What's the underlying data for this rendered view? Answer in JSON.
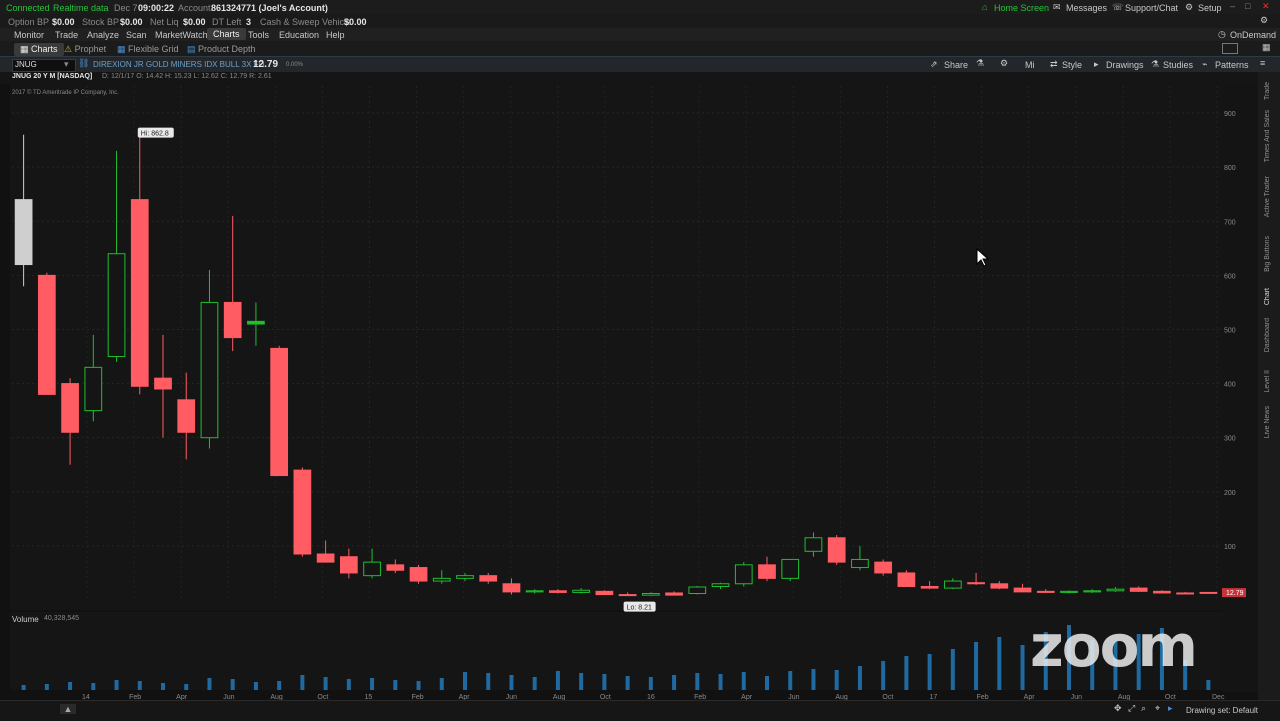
{
  "status": {
    "connected": "Connected",
    "realtime": "Realtime data",
    "date": "Dec 7",
    "time": "09:00:22",
    "account_label": "Account:",
    "account_value": "861324771 (Joel's Account)"
  },
  "balances": [
    {
      "label": "Option BP",
      "value": "$0.00"
    },
    {
      "label": "Stock BP",
      "value": "$0.00"
    },
    {
      "label": "Net Liq",
      "value": "$0.00"
    },
    {
      "label": "DT Left",
      "value": "3"
    },
    {
      "label": "Cash & Sweep Vehicle",
      "value": "$0.00"
    }
  ],
  "top_right": {
    "home": "Home Screen",
    "messages": "Messages",
    "support": "Support/Chat",
    "setup": "Setup",
    "ondemand": "OnDemand"
  },
  "menu": [
    "Monitor",
    "Trade",
    "Analyze",
    "Scan",
    "MarketWatch",
    "Charts",
    "Tools",
    "Education",
    "Help"
  ],
  "subtabs": [
    "Charts",
    "Prophet",
    "Flexible Grid",
    "Product Depth"
  ],
  "chart_header": {
    "symbol": "JNUG",
    "description": "DIREXION JR GOLD MINERS IDX BULL 3X FD",
    "price": "12.79",
    "change": "0.00%",
    "toolbar": [
      "Share",
      "Mi",
      "Style",
      "Drawings",
      "Studies",
      "Patterns"
    ]
  },
  "chart_stats": {
    "title": "JNUG 20 Y M [NASDAQ]",
    "ohlc": "D: 12/1/17   O: 14.42   H: 15.23   L: 12.62   C: 12.79   R: 2.61",
    "copyright": "2017 © TD Ameritrade IP Company, Inc."
  },
  "right_sidebar": [
    "Trade",
    "Times And Sales",
    "Active Trader",
    "Big Buttons",
    "Chart",
    "Dashboard",
    "Level II",
    "Live News"
  ],
  "volume_label": "Volume",
  "volume_value": "40,328,545",
  "drawing_set": "Drawing set: Default",
  "watermark": "zoom",
  "chart_data": {
    "type": "candlestick",
    "title": "JNUG 20 Y M [NASDAQ]",
    "ylim": [
      0,
      950
    ],
    "y_ticks": [
      900,
      800,
      700,
      600,
      500,
      400,
      300,
      200,
      100
    ],
    "x_labels": [
      "14",
      "Feb",
      "Apr",
      "Jun",
      "Aug",
      "Oct",
      "15",
      "Feb",
      "Apr",
      "Jun",
      "Aug",
      "Oct",
      "16",
      "Feb",
      "Apr",
      "Jun",
      "Aug",
      "Oct",
      "17",
      "Feb",
      "Apr",
      "Jun",
      "Aug",
      "Oct",
      "Dec"
    ],
    "hi_label": "Hi: 862.8",
    "lo_label": "Lo: 8.21",
    "last_label": "12.79",
    "colors": {
      "up": "#1fbf2e",
      "down": "#ff5c63",
      "volume": "#1f6aa0"
    },
    "candles": [
      {
        "o": 620,
        "h": 860,
        "l": 580,
        "c": 740
      },
      {
        "o": 600,
        "h": 605,
        "l": 380,
        "c": 380
      },
      {
        "o": 400,
        "h": 410,
        "l": 250,
        "c": 310
      },
      {
        "o": 350,
        "h": 490,
        "l": 330,
        "c": 430
      },
      {
        "o": 450,
        "h": 830,
        "l": 440,
        "c": 640
      },
      {
        "o": 740,
        "h": 862,
        "l": 380,
        "c": 395
      },
      {
        "o": 410,
        "h": 490,
        "l": 300,
        "c": 390
      },
      {
        "o": 370,
        "h": 420,
        "l": 260,
        "c": 310
      },
      {
        "o": 300,
        "h": 610,
        "l": 280,
        "c": 550
      },
      {
        "o": 550,
        "h": 710,
        "l": 460,
        "c": 485
      },
      {
        "o": 510,
        "h": 550,
        "l": 470,
        "c": 515
      },
      {
        "o": 465,
        "h": 470,
        "l": 230,
        "c": 230
      },
      {
        "o": 240,
        "h": 245,
        "l": 80,
        "c": 85
      },
      {
        "o": 85,
        "h": 110,
        "l": 70,
        "c": 70
      },
      {
        "o": 80,
        "h": 95,
        "l": 40,
        "c": 50
      },
      {
        "o": 45,
        "h": 95,
        "l": 40,
        "c": 70
      },
      {
        "o": 65,
        "h": 75,
        "l": 50,
        "c": 55
      },
      {
        "o": 60,
        "h": 65,
        "l": 30,
        "c": 35
      },
      {
        "o": 35,
        "h": 55,
        "l": 30,
        "c": 40
      },
      {
        "o": 40,
        "h": 50,
        "l": 35,
        "c": 45
      },
      {
        "o": 45,
        "h": 50,
        "l": 30,
        "c": 35
      },
      {
        "o": 30,
        "h": 40,
        "l": 10,
        "c": 15
      },
      {
        "o": 15,
        "h": 20,
        "l": 12,
        "c": 17
      },
      {
        "o": 17,
        "h": 20,
        "l": 12,
        "c": 14
      },
      {
        "o": 14,
        "h": 22,
        "l": 12,
        "c": 18
      },
      {
        "o": 16,
        "h": 18,
        "l": 10,
        "c": 10
      },
      {
        "o": 10,
        "h": 14,
        "l": 8,
        "c": 9
      },
      {
        "o": 9,
        "h": 14,
        "l": 8,
        "c": 12
      },
      {
        "o": 13,
        "h": 16,
        "l": 9,
        "c": 9
      },
      {
        "o": 12,
        "h": 26,
        "l": 10,
        "c": 24
      },
      {
        "o": 25,
        "h": 32,
        "l": 20,
        "c": 30
      },
      {
        "o": 30,
        "h": 70,
        "l": 25,
        "c": 65
      },
      {
        "o": 65,
        "h": 80,
        "l": 35,
        "c": 40
      },
      {
        "o": 40,
        "h": 70,
        "l": 35,
        "c": 75
      },
      {
        "o": 90,
        "h": 125,
        "l": 80,
        "c": 115
      },
      {
        "o": 115,
        "h": 120,
        "l": 65,
        "c": 70
      },
      {
        "o": 60,
        "h": 100,
        "l": 55,
        "c": 75
      },
      {
        "o": 70,
        "h": 75,
        "l": 45,
        "c": 50
      },
      {
        "o": 50,
        "h": 55,
        "l": 25,
        "c": 25
      },
      {
        "o": 25,
        "h": 35,
        "l": 20,
        "c": 22
      },
      {
        "o": 22,
        "h": 40,
        "l": 20,
        "c": 35
      },
      {
        "o": 32,
        "h": 50,
        "l": 28,
        "c": 30
      },
      {
        "o": 30,
        "h": 35,
        "l": 20,
        "c": 22
      },
      {
        "o": 22,
        "h": 30,
        "l": 15,
        "c": 15
      },
      {
        "o": 16,
        "h": 20,
        "l": 14,
        "c": 14
      },
      {
        "o": 14,
        "h": 18,
        "l": 12,
        "c": 16
      },
      {
        "o": 15,
        "h": 20,
        "l": 13,
        "c": 17
      },
      {
        "o": 17,
        "h": 24,
        "l": 15,
        "c": 20
      },
      {
        "o": 22,
        "h": 25,
        "l": 15,
        "c": 16
      },
      {
        "o": 16,
        "h": 18,
        "l": 12,
        "c": 13
      },
      {
        "o": 13,
        "h": 15,
        "l": 11,
        "c": 12
      },
      {
        "o": 14,
        "h": 15,
        "l": 12,
        "c": 12.79
      }
    ],
    "volume": [
      0.5,
      0.6,
      0.8,
      0.7,
      1.0,
      0.9,
      0.7,
      0.6,
      1.2,
      1.1,
      0.8,
      0.9,
      1.5,
      1.3,
      1.1,
      1.2,
      1.0,
      0.9,
      1.2,
      1.8,
      1.7,
      1.5,
      1.3,
      1.9,
      1.7,
      1.6,
      1.4,
      1.3,
      1.5,
      1.7,
      1.6,
      1.8,
      1.4,
      1.9,
      2.1,
      2.0,
      2.4,
      2.9,
      3.4,
      3.6,
      4.1,
      4.8,
      5.3,
      4.5,
      5.8,
      6.5,
      5.0,
      4.8,
      5.6,
      6.2,
      3.0,
      1.0
    ]
  }
}
